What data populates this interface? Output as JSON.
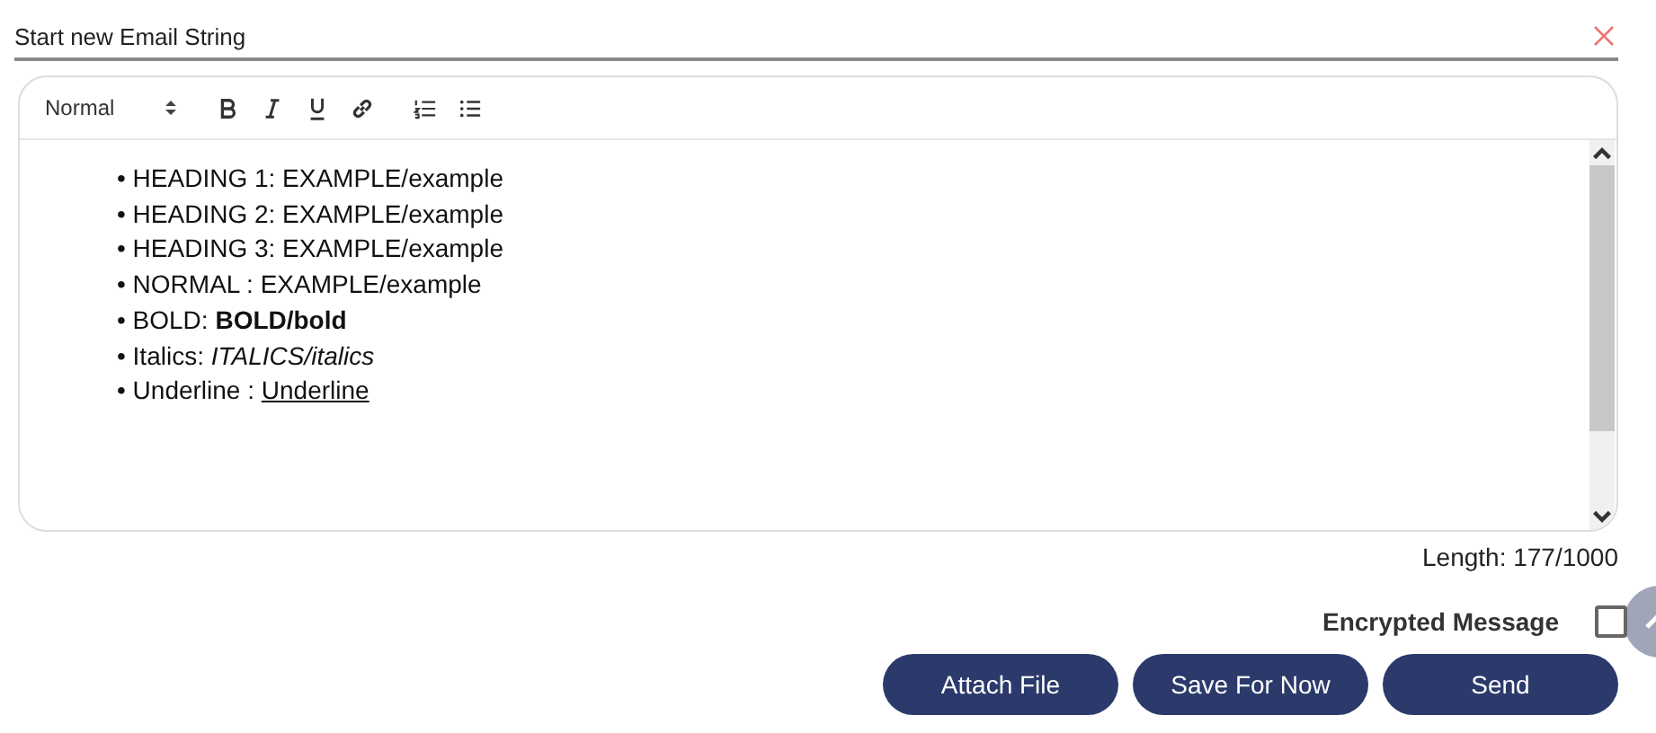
{
  "title": "Start new Email String",
  "toolbar": {
    "format": "Normal"
  },
  "content": [
    {
      "label": "HEADING 1: ",
      "value": "EXAMPLE/example",
      "kind": "plain"
    },
    {
      "label": "HEADING 2: ",
      "value": "EXAMPLE/example",
      "kind": "plain"
    },
    {
      "label": "HEADING 3: ",
      "value": "EXAMPLE/example",
      "kind": "plain"
    },
    {
      "label": "NORMAL : ",
      "value": "EXAMPLE/example",
      "kind": "plain"
    },
    {
      "label": "BOLD: ",
      "value": "BOLD/bold",
      "kind": "bold"
    },
    {
      "label": "Italics: ",
      "value": "ITALICS/italics",
      "kind": "italic"
    },
    {
      "label": "Underline : ",
      "value": "Underline",
      "kind": "underline"
    }
  ],
  "bullet": "•",
  "length": "Length: 177/1000",
  "encrypted": {
    "label": "Encrypted Message",
    "checked": false
  },
  "buttons": [
    "Attach File",
    "Save For Now",
    "Send"
  ]
}
